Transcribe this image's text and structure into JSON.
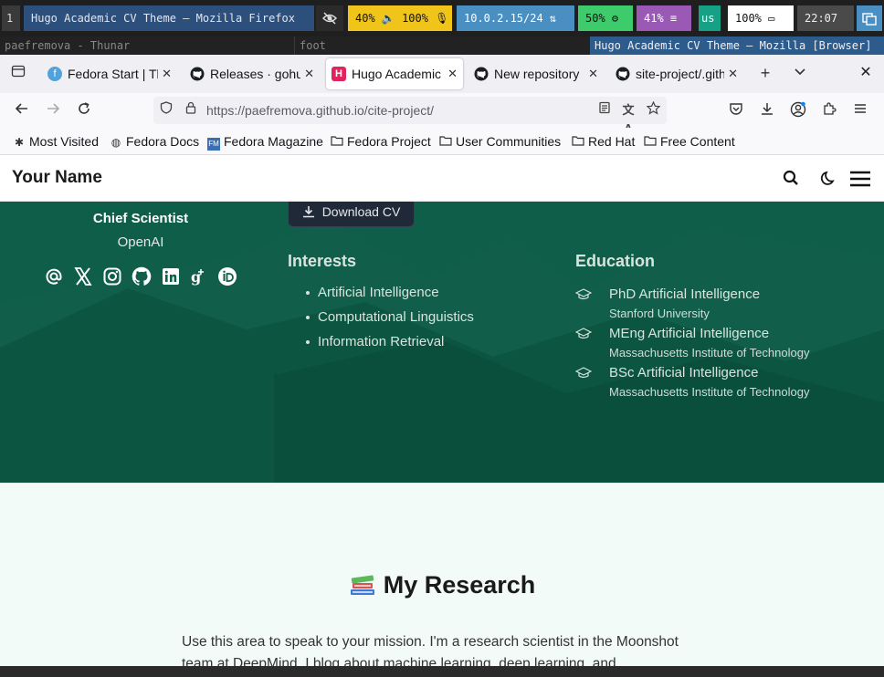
{
  "swaybar": {
    "workspace": "1",
    "window_title": "Hugo Academic CV Theme — Mozilla Firefox",
    "audio": "40% 🔈 100% 🎙",
    "network": "10.0.2.15/24 ⇅",
    "cpu": "50% ⚙",
    "memory": "41% ≡",
    "keyboard": "us",
    "battery": "100% ▭",
    "clock": "22:07",
    "colors": {
      "audio": "#f0c419",
      "network": "#4a8fc1",
      "cpu": "#3ecb6c",
      "memory": "#9b59b6",
      "keyboard": "#16a085"
    }
  },
  "sway_tabs": [
    "paefremova - Thunar",
    "foot",
    "Hugo Academic CV Theme — Mozilla [Browser]"
  ],
  "browser": {
    "tabs": [
      {
        "label": "Fedora Start | Th",
        "icon": "fedora-icon"
      },
      {
        "label": "Releases · gohug",
        "icon": "github-icon"
      },
      {
        "label": "Hugo Academic C",
        "icon": "hugo-icon",
        "active": true
      },
      {
        "label": "New repository",
        "icon": "github-icon"
      },
      {
        "label": "site-project/.gith",
        "icon": "github-icon"
      }
    ],
    "url": "https://paefremova.github.io/cite-project/",
    "bookmarks": [
      "Most Visited",
      "Fedora Docs",
      "Fedora Magazine",
      "Fedora Project",
      "User Communities",
      "Red Hat",
      "Free Content"
    ]
  },
  "site": {
    "brand": "Your Name",
    "download_cv": "Download CV",
    "role": "Chief Scientist",
    "organization": "OpenAI",
    "social_icons": [
      "at-icon",
      "x-icon",
      "instagram-icon",
      "github-icon",
      "linkedin-icon",
      "google-scholar-icon",
      "orcid-icon"
    ],
    "interests_heading": "Interests",
    "interests": [
      "Artificial Intelligence",
      "Computational Linguistics",
      "Information Retrieval"
    ],
    "education_heading": "Education",
    "education": [
      {
        "degree": "PhD Artificial Intelligence",
        "institution": "Stanford University"
      },
      {
        "degree": "MEng Artificial Intelligence",
        "institution": "Massachusetts Institute of Technology"
      },
      {
        "degree": "BSc Artificial Intelligence",
        "institution": "Massachusetts Institute of Technology"
      }
    ],
    "research_title": "My Research",
    "research_text_line1": "Use this area to speak to your mission. I'm a research scientist in the Moonshot",
    "research_text_line2": "team at DeepMind. I blog about machine learning, deep learning, and",
    "hero_color": "#0f5e49"
  }
}
